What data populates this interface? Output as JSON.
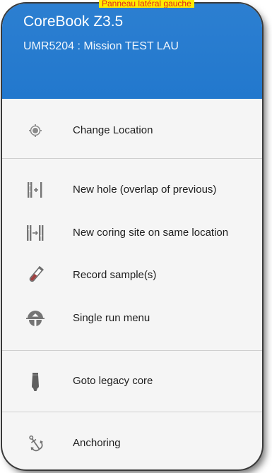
{
  "annotation": "Panneau latéral gauche",
  "header": {
    "title": "CoreBook Z3.5",
    "subtitle": "UMR5204 : Mission TEST LAU"
  },
  "menu": {
    "items": [
      {
        "label": "Change Location",
        "icon": "location-target-icon"
      },
      {
        "label": "New hole (overlap of previous)",
        "icon": "new-hole-icon"
      },
      {
        "label": "New coring site on same location",
        "icon": "new-coring-site-icon"
      },
      {
        "label": "Record sample(s)",
        "icon": "test-tube-icon"
      },
      {
        "label": "Single run menu",
        "icon": "single-run-icon"
      },
      {
        "label": "Goto legacy core",
        "icon": "legacy-core-icon"
      },
      {
        "label": "Anchoring",
        "icon": "anchor-icon"
      }
    ]
  },
  "colors": {
    "header": "#2278cd",
    "drawer_background": "#f5f5f5",
    "icon": "#757575",
    "text": "#1e1e1e",
    "annotation_background": "#ffeb00",
    "annotation_text": "#e0261b"
  }
}
